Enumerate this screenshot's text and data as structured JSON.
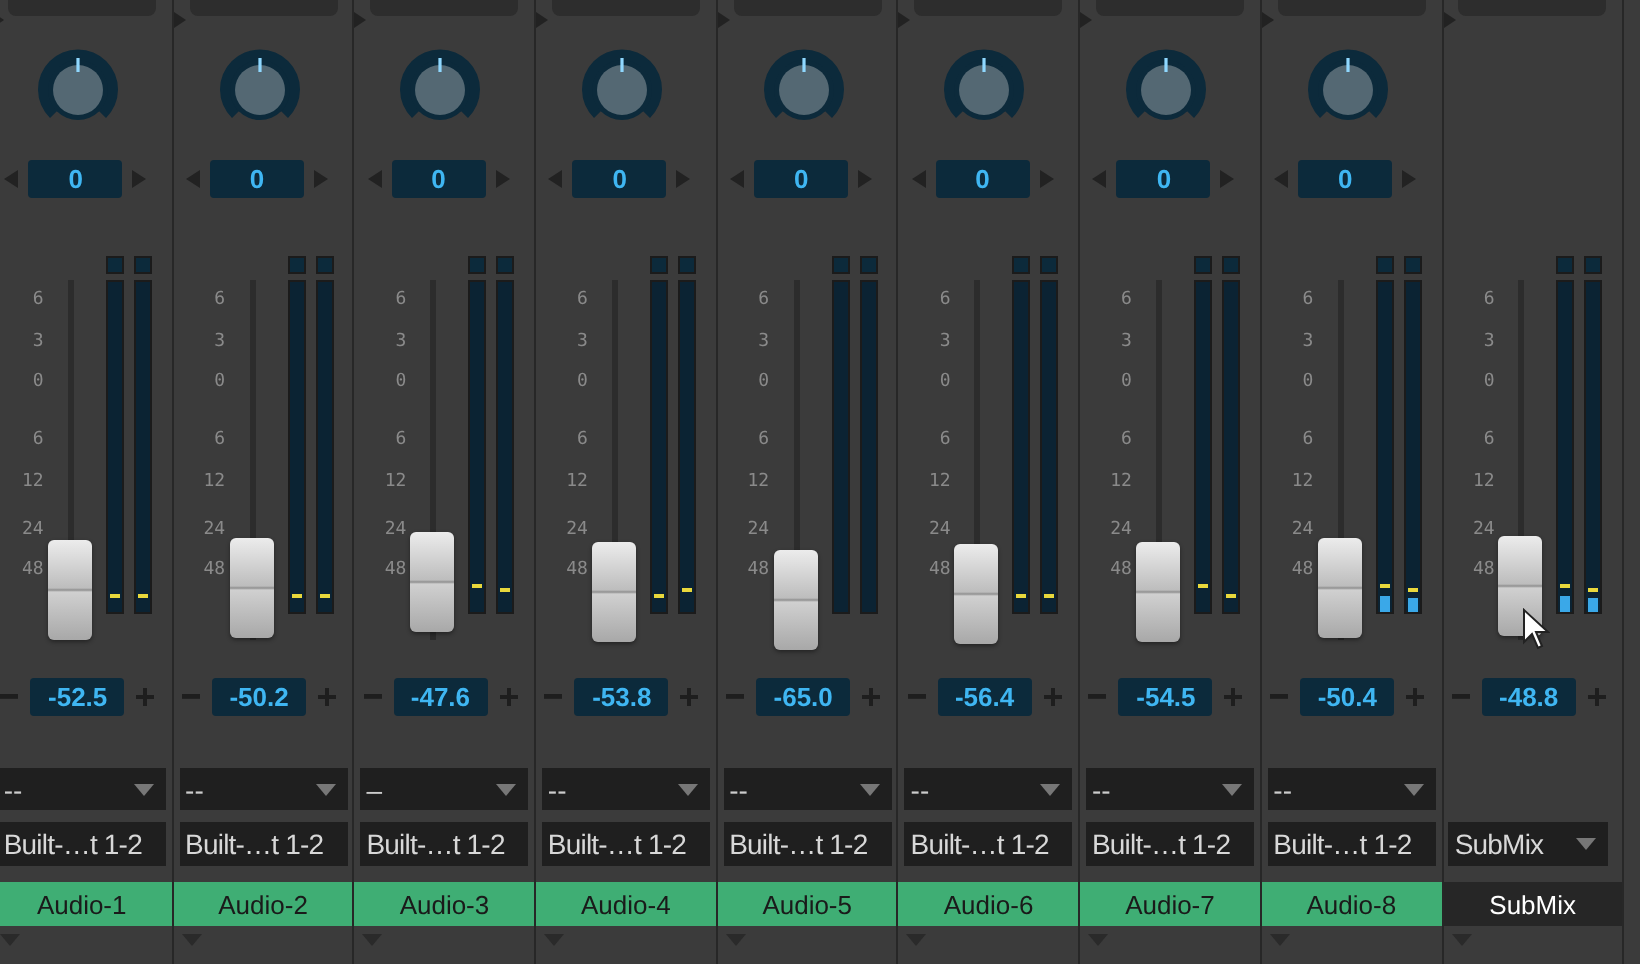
{
  "channels": [
    {
      "kind": "audio",
      "pan": "0",
      "scale": [
        "6",
        "3",
        "0",
        "6",
        "12",
        "24",
        "48"
      ],
      "fader": {
        "level": 0.14
      },
      "meters": [
        {
          "peak": {
            "level": 0.04
          }
        },
        {
          "peak": {
            "level": 0.04
          }
        }
      ],
      "volume": "-52.5",
      "output": "--",
      "input": "Built-…t 1-2",
      "name": "Audio-1",
      "color": "#3fae74"
    },
    {
      "kind": "audio",
      "pan": "0",
      "scale": [
        "6",
        "3",
        "0",
        "6",
        "12",
        "24",
        "48"
      ],
      "fader": {
        "level": 0.145
      },
      "meters": [
        {
          "peak": {
            "level": 0.04
          }
        },
        {
          "peak": {
            "level": 0.04
          }
        }
      ],
      "volume": "-50.2",
      "output": "--",
      "input": "Built-…t 1-2",
      "name": "Audio-2",
      "color": "#3fae74"
    },
    {
      "kind": "audio",
      "pan": "0",
      "scale": [
        "6",
        "3",
        "0",
        "6",
        "12",
        "24",
        "48"
      ],
      "fader": {
        "level": 0.16
      },
      "meters": [
        {
          "peak": {
            "level": 0.07
          }
        },
        {
          "peak": {
            "level": 0.06
          }
        }
      ],
      "volume": "-47.6",
      "output": "–",
      "input": "Built-…t 1-2",
      "name": "Audio-3",
      "color": "#3fae74"
    },
    {
      "kind": "audio",
      "pan": "0",
      "scale": [
        "6",
        "3",
        "0",
        "6",
        "12",
        "24",
        "48"
      ],
      "fader": {
        "level": 0.135
      },
      "meters": [
        {
          "peak": {
            "level": 0.04
          }
        },
        {
          "peak": {
            "level": 0.06
          }
        }
      ],
      "volume": "-53.8",
      "output": "--",
      "input": "Built-…t 1-2",
      "name": "Audio-4",
      "color": "#3fae74"
    },
    {
      "kind": "audio",
      "pan": "0",
      "scale": [
        "6",
        "3",
        "0",
        "6",
        "12",
        "24",
        "48"
      ],
      "fader": {
        "level": 0.11
      },
      "volume": "-65.0",
      "output": "--",
      "input": "Built-…t 1-2",
      "name": "Audio-5",
      "color": "#3fae74"
    },
    {
      "kind": "audio",
      "pan": "0",
      "scale": [
        "6",
        "3",
        "0",
        "6",
        "12",
        "24",
        "48"
      ],
      "fader": {
        "level": 0.13
      },
      "meters": [
        {
          "peak": {
            "level": 0.04
          }
        },
        {
          "peak": {
            "level": 0.04
          }
        }
      ],
      "volume": "-56.4",
      "output": "--",
      "input": "Built-…t 1-2",
      "name": "Audio-6",
      "color": "#3fae74"
    },
    {
      "kind": "audio",
      "pan": "0",
      "scale": [
        "6",
        "3",
        "0",
        "6",
        "12",
        "24",
        "48"
      ],
      "fader": {
        "level": 0.135
      },
      "meters": [
        {
          "peak": {
            "level": 0.07
          }
        },
        {
          "peak": {
            "level": 0.04
          }
        }
      ],
      "volume": "-54.5",
      "output": "--",
      "input": "Built-…t 1-2",
      "name": "Audio-7",
      "color": "#3fae74"
    },
    {
      "kind": "audio",
      "pan": "0",
      "scale": [
        "6",
        "3",
        "0",
        "6",
        "12",
        "24",
        "48"
      ],
      "fader": {
        "level": 0.145
      },
      "meters": [
        {
          "level": 0.05,
          "peak": {
            "level": 0.07
          }
        },
        {
          "level": 0.04,
          "peak": {
            "level": 0.06
          }
        }
      ],
      "volume": "-50.4",
      "output": "--",
      "input": "Built-…t 1-2",
      "name": "Audio-8",
      "color": "#3fae74"
    },
    {
      "kind": "bus",
      "scale": [
        "6",
        "3",
        "0",
        "6",
        "12",
        "24",
        "48"
      ],
      "fader": {
        "level": 0.15
      },
      "meters": [
        {
          "level": 0.05,
          "peak": {
            "level": 0.07
          }
        },
        {
          "level": 0.04,
          "peak": {
            "level": 0.06
          }
        }
      ],
      "volume": "-48.8",
      "input": "SubMix",
      "name": "SubMix",
      "color": "#262626"
    }
  ]
}
